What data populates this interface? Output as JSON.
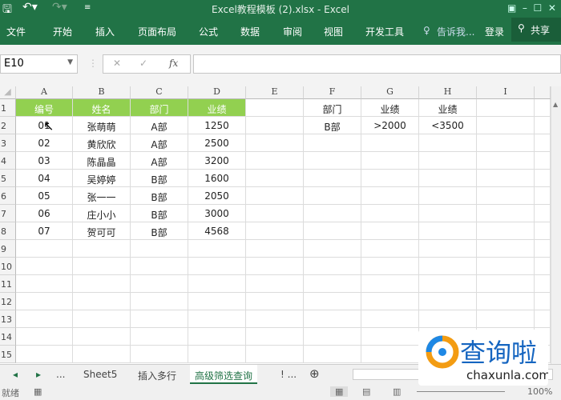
{
  "window": {
    "title": "Excel教程模板 (2).xlsx - Excel"
  },
  "ribbon": {
    "tabs": [
      "文件",
      "开始",
      "插入",
      "页面布局",
      "公式",
      "数据",
      "审阅",
      "视图",
      "开发工具"
    ],
    "tell_me": "告诉我...",
    "login": "登录",
    "share": "共享"
  },
  "formula_bar": {
    "name_box": "E10",
    "fx": "fx",
    "value": ""
  },
  "columns": [
    "A",
    "B",
    "C",
    "D",
    "E",
    "F",
    "G",
    "H",
    "I"
  ],
  "rows": [
    "1",
    "2",
    "3",
    "4",
    "5",
    "6",
    "7",
    "8",
    "9",
    "10",
    "11",
    "12",
    "13",
    "14",
    "15"
  ],
  "table": {
    "headers": [
      "编号",
      "姓名",
      "部门",
      "业绩"
    ],
    "rows": [
      [
        "01",
        "张萌萌",
        "A部",
        "1250"
      ],
      [
        "02",
        "黄欣欣",
        "A部",
        "2500"
      ],
      [
        "03",
        "陈晶晶",
        "A部",
        "3200"
      ],
      [
        "04",
        "吴婷婷",
        "B部",
        "1600"
      ],
      [
        "05",
        "张一一",
        "B部",
        "2050"
      ],
      [
        "06",
        "庄小小",
        "B部",
        "3000"
      ],
      [
        "07",
        "贺可可",
        "B部",
        "4568"
      ]
    ]
  },
  "criteria": {
    "headers": [
      "部门",
      "业绩",
      "业绩"
    ],
    "values": [
      "B部",
      ">2000",
      "<3500"
    ]
  },
  "sheet_tabs": {
    "prev": "◂",
    "next": "▸",
    "more": "...",
    "tabs": [
      "Sheet5",
      "插入多行",
      "高级筛选查询"
    ],
    "more2": "! ...",
    "add": "⊕"
  },
  "status": {
    "ready": "就绪",
    "zoom": "100%"
  },
  "watermark": {
    "text": "查询啦",
    "url": "chaxunla.com"
  },
  "colors": {
    "excel_green": "#217346",
    "header_fill": "#92d050"
  }
}
